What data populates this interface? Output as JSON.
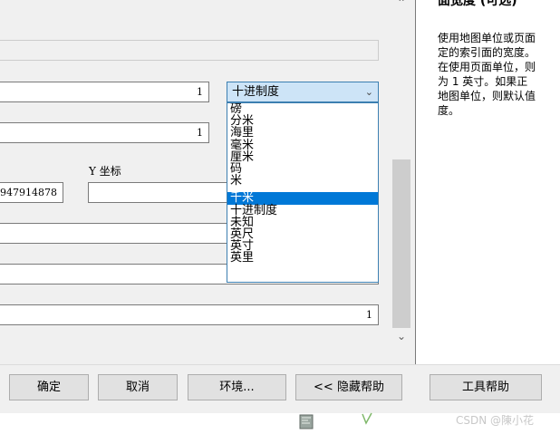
{
  "help": {
    "title": "面宽度 (可选)",
    "text": "使用地图单位或页面\n定的索引面的宽度。\n在使用页面单位，则\n为 1 英寸。如果正\n地图单位，则默认值\n度。"
  },
  "fields": {
    "width_value": "1",
    "height_value": "1",
    "x_coord_value": "947914878",
    "y_coord_label": "Y 坐标",
    "y_coord_value": "",
    "bottom_value": "1"
  },
  "unit_select": {
    "selected": "十进制度",
    "options": [
      "磅",
      "分米",
      "海里",
      "毫米",
      "厘米",
      "码",
      "米",
      "千米",
      "十进制度",
      "未知",
      "英尺",
      "英寸",
      "英里"
    ],
    "highlighted": "千米"
  },
  "buttons": {
    "ok": "确定",
    "cancel": "取消",
    "env": "环境...",
    "hide_help": "<< 隐藏帮助",
    "tool_help": "工具帮助"
  },
  "watermark": "CSDN @陳小花",
  "icons": {
    "scroll_up": "chevron-up-icon",
    "scroll_down": "chevron-down-icon",
    "dropdown": "chevron-down-icon"
  }
}
